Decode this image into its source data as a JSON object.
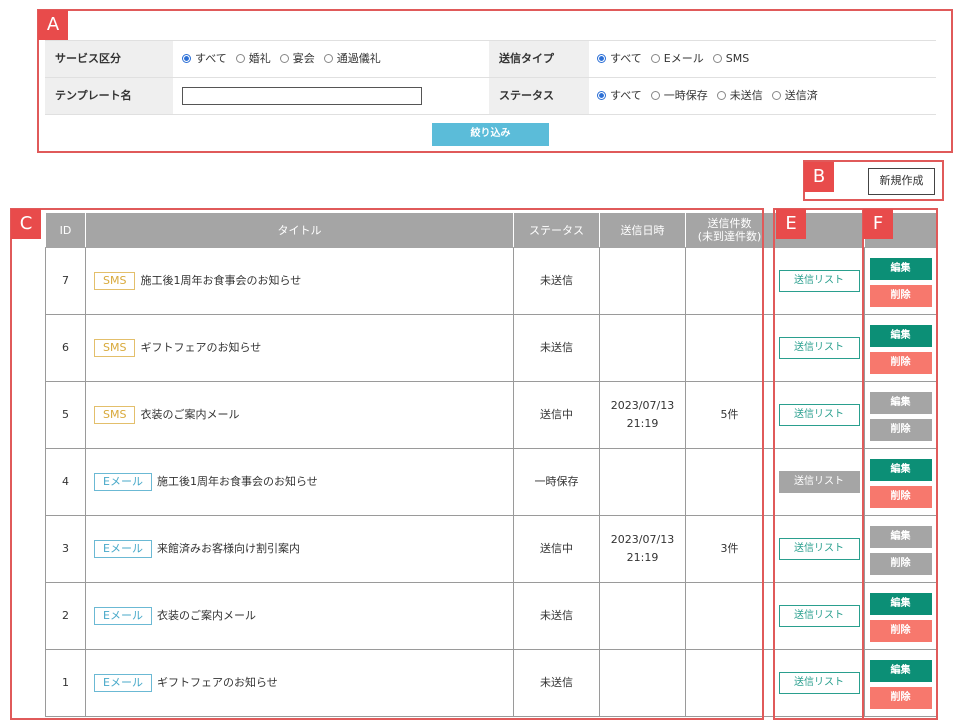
{
  "annotations": {
    "a": "A",
    "b": "B",
    "c": "C",
    "e": "E",
    "f": "F"
  },
  "filter": {
    "service_label": "サービス区分",
    "service_options": [
      "すべて",
      "婚礼",
      "宴会",
      "通過儀礼"
    ],
    "service_selected": 0,
    "send_type_label": "送信タイプ",
    "send_type_options": [
      "すべて",
      "Eメール",
      "SMS"
    ],
    "send_type_selected": 0,
    "template_label": "テンプレート名",
    "template_value": "",
    "status_label": "ステータス",
    "status_options": [
      "すべて",
      "一時保存",
      "未送信",
      "送信済"
    ],
    "status_selected": 0,
    "filter_button": "絞り込み"
  },
  "new_button": "新規作成",
  "table": {
    "headers": {
      "id": "ID",
      "title": "タイトル",
      "status": "ステータス",
      "sent_at": "送信日時",
      "count_line1": "送信件数",
      "count_line2": "(未到達件数)"
    },
    "list_button": "送信リスト",
    "edit_button": "編集",
    "delete_button": "削除",
    "rows": [
      {
        "id": "7",
        "type": "SMS",
        "title": "施工後1周年お食事会のお知らせ",
        "status": "未送信",
        "date": "",
        "time": "",
        "count": "",
        "list_disabled": false,
        "actions_disabled": false
      },
      {
        "id": "6",
        "type": "SMS",
        "title": "ギフトフェアのお知らせ",
        "status": "未送信",
        "date": "",
        "time": "",
        "count": "",
        "list_disabled": false,
        "actions_disabled": false
      },
      {
        "id": "5",
        "type": "SMS",
        "title": "衣装のご案内メール",
        "status": "送信中",
        "date": "2023/07/13",
        "time": "21:19",
        "count": "5件",
        "list_disabled": false,
        "actions_disabled": true
      },
      {
        "id": "4",
        "type": "Eメール",
        "title": "施工後1周年お食事会のお知らせ",
        "status": "一時保存",
        "date": "",
        "time": "",
        "count": "",
        "list_disabled": true,
        "actions_disabled": false
      },
      {
        "id": "3",
        "type": "Eメール",
        "title": "来館済みお客様向け割引案内",
        "status": "送信中",
        "date": "2023/07/13",
        "time": "21:19",
        "count": "3件",
        "list_disabled": false,
        "actions_disabled": true
      },
      {
        "id": "2",
        "type": "Eメール",
        "title": "衣装のご案内メール",
        "status": "未送信",
        "date": "",
        "time": "",
        "count": "",
        "list_disabled": false,
        "actions_disabled": false
      },
      {
        "id": "1",
        "type": "Eメール",
        "title": "ギフトフェアのお知らせ",
        "status": "未送信",
        "date": "",
        "time": "",
        "count": "",
        "list_disabled": false,
        "actions_disabled": false
      }
    ]
  }
}
